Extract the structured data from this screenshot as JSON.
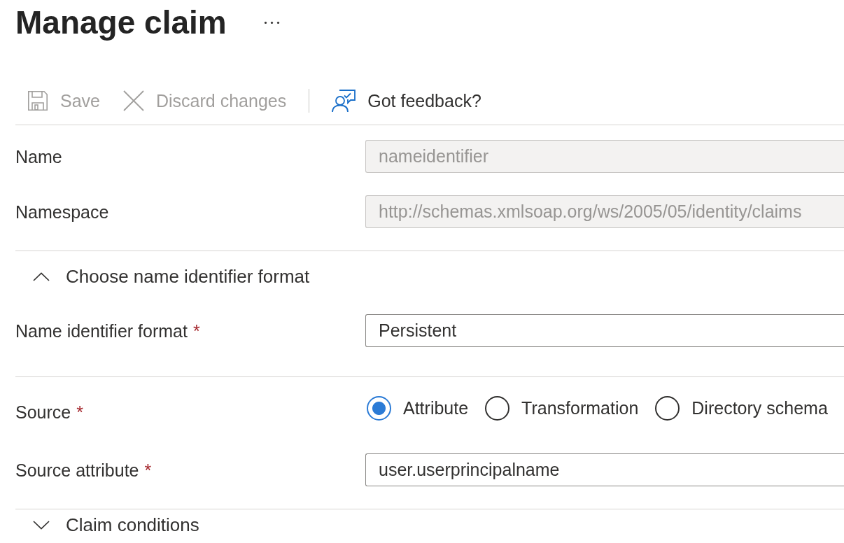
{
  "header": {
    "title": "Manage claim"
  },
  "toolbar": {
    "groups": [
      {
        "items": [
          {
            "kind": "save",
            "label": "Save",
            "disabled": true
          },
          {
            "kind": "discard",
            "label": "Discard changes",
            "disabled": true
          }
        ]
      },
      {
        "items": [
          {
            "kind": "feedback",
            "label": "Got feedback?",
            "disabled": false
          }
        ]
      }
    ]
  },
  "sections": [
    {
      "kind": "plain",
      "rows": [
        {
          "kind": "text",
          "label": "Name",
          "value": "nameidentifier",
          "disabled": true
        },
        {
          "kind": "text",
          "label": "Namespace",
          "value": "http://schemas.xmlsoap.org/ws/2005/05/identity/claims",
          "disabled": true
        }
      ]
    },
    {
      "kind": "collapsible",
      "title": "Choose name identifier format",
      "expanded": true,
      "rows": [
        {
          "kind": "text",
          "label": "Name identifier format",
          "required_mark": "*",
          "value": "Persistent",
          "disabled": false
        }
      ]
    },
    {
      "kind": "plain",
      "rows": [
        {
          "kind": "radio",
          "label": "Source",
          "required_mark": "*",
          "options": [
            {
              "label": "Attribute",
              "selected": true
            },
            {
              "label": "Transformation",
              "selected": false
            },
            {
              "label": "Directory schema",
              "selected": false
            }
          ]
        },
        {
          "kind": "text",
          "label": "Source attribute",
          "required_mark": "*",
          "value": "user.userprincipalname",
          "disabled": false
        }
      ]
    },
    {
      "kind": "collapsible",
      "title": "Claim conditions",
      "expanded": false
    }
  ]
}
